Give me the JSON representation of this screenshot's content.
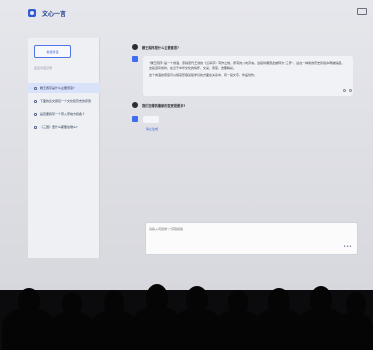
{
  "app": {
    "title": "文心一言"
  },
  "sidebar": {
    "new_chat_label": "新建对话",
    "history_label": "最近对话记录",
    "items": [
      {
        "label": "滕王阁序是什么主要意思?",
        "active": true
      },
      {
        "label": "下面的论文题目一个文化和历史的原因",
        "active": false
      },
      {
        "label": "是否要我写一个带入带地方和各个",
        "active": false
      },
      {
        "label": "《三国》里什么都要最难么?",
        "active": false
      }
    ]
  },
  "conversation": {
    "question1": "滕王阁序是什么主要意思?",
    "answer_para1": "“滕王阁序”是一个成语，原指唐代王勃的《兰亭序》写作之前，所写的八句序言。这段时期因此被称为“三界”，后在一种新的历史阶段中再被提起。这段话写成时，在记于中华文化的情怀，文采，意思，含蓄精彩。",
    "answer_para2": "这个成语的意思可以用来形容某些学识的方面在关系中，有一段文字，作品创作。",
    "question2": "我们在哪的最新的变更是要多?",
    "stop_label": "停止生成"
  },
  "input": {
    "placeholder": "请输入问题或“/”获取模板"
  },
  "colors": {
    "accent": "#2f5bd7",
    "screen_bg": "#e2e3e8",
    "room_bg": "#0b0b0d"
  }
}
